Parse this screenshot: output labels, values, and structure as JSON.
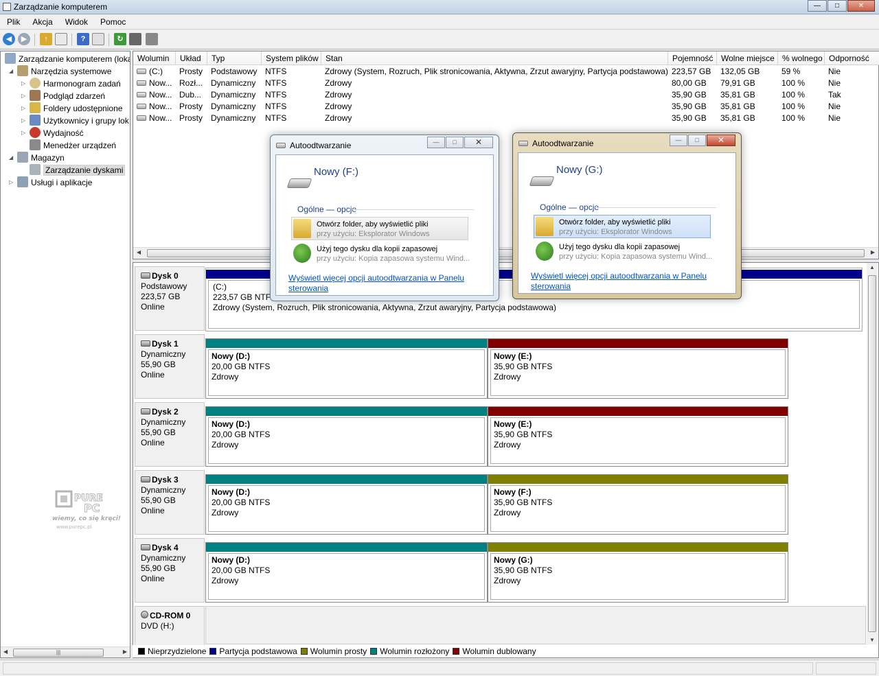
{
  "window": {
    "title": "Zarządzanie komputerem",
    "min": "—",
    "max": "□",
    "close": "✕"
  },
  "menu": [
    "Plik",
    "Akcja",
    "Widok",
    "Pomoc"
  ],
  "tree": {
    "root": "Zarządzanie komputerem (loka",
    "system_tools": "Narzędzia systemowe",
    "task_scheduler": "Harmonogram zadań",
    "event_viewer": "Podgląd zdarzeń",
    "shared_folders": "Foldery udostępnione",
    "users_groups": "Użytkownicy i grupy lok",
    "performance": "Wydajność",
    "device_manager": "Menedżer urządzeń",
    "storage": "Magazyn",
    "disk_management": "Zarządzanie dyskami",
    "services": "Usługi i aplikacje"
  },
  "volumes": {
    "columns": [
      "Wolumin",
      "Układ",
      "Typ",
      "System plików",
      "Stan",
      "Pojemność",
      "Wolne miejsce",
      "% wolnego",
      "Odporność"
    ],
    "rows": [
      [
        "(C:)",
        "Prosty",
        "Podstawowy",
        "NTFS",
        "Zdrowy (System, Rozruch, Plik stronicowania, Aktywna, Zrzut awaryjny, Partycja podstawowa)",
        "223,57 GB",
        "132,05 GB",
        "59 %",
        "Nie"
      ],
      [
        "Now...",
        "Rozł...",
        "Dynamiczny",
        "NTFS",
        "Zdrowy",
        "80,00 GB",
        "79,91 GB",
        "100 %",
        "Nie"
      ],
      [
        "Now...",
        "Dub...",
        "Dynamiczny",
        "NTFS",
        "Zdrowy",
        "35,90 GB",
        "35,81 GB",
        "100 %",
        "Tak"
      ],
      [
        "Now...",
        "Prosty",
        "Dynamiczny",
        "NTFS",
        "Zdrowy",
        "35,90 GB",
        "35,81 GB",
        "100 %",
        "Nie"
      ],
      [
        "Now...",
        "Prosty",
        "Dynamiczny",
        "NTFS",
        "Zdrowy",
        "35,90 GB",
        "35,81 GB",
        "100 %",
        "Nie"
      ]
    ]
  },
  "disks": {
    "disk0": {
      "name": "Dysk 0",
      "type": "Podstawowy",
      "size": "223,57 GB",
      "status": "Online",
      "p0": {
        "name": "(C:)",
        "size": "223,57 GB NTFS",
        "status": "Zdrowy (System, Rozruch, Plik stronicowania, Aktywna, Zrzut awaryjny, Partycja podstawowa)"
      }
    },
    "disk1": {
      "name": "Dysk 1",
      "type": "Dynamiczny",
      "size": "55,90 GB",
      "status": "Online",
      "p0": {
        "name": "Nowy  (D:)",
        "size": "20,00 GB NTFS",
        "status": "Zdrowy"
      },
      "p1": {
        "name": "Nowy  (E:)",
        "size": "35,90 GB NTFS",
        "status": "Zdrowy"
      }
    },
    "disk2": {
      "name": "Dysk 2",
      "type": "Dynamiczny",
      "size": "55,90 GB",
      "status": "Online",
      "p0": {
        "name": "Nowy  (D:)",
        "size": "20,00 GB NTFS",
        "status": "Zdrowy"
      },
      "p1": {
        "name": "Nowy  (E:)",
        "size": "35,90 GB NTFS",
        "status": "Zdrowy"
      }
    },
    "disk3": {
      "name": "Dysk 3",
      "type": "Dynamiczny",
      "size": "55,90 GB",
      "status": "Online",
      "p0": {
        "name": "Nowy  (D:)",
        "size": "20,00 GB NTFS",
        "status": "Zdrowy"
      },
      "p1": {
        "name": "Nowy  (F:)",
        "size": "35,90 GB NTFS",
        "status": "Zdrowy"
      }
    },
    "disk4": {
      "name": "Dysk 4",
      "type": "Dynamiczny",
      "size": "55,90 GB",
      "status": "Online",
      "p0": {
        "name": "Nowy  (D:)",
        "size": "20,00 GB NTFS",
        "status": "Zdrowy"
      },
      "p1": {
        "name": "Nowy  (G:)",
        "size": "35,90 GB NTFS",
        "status": "Zdrowy"
      }
    },
    "cdrom": {
      "name": "CD-ROM 0",
      "type": "DVD (H:)"
    }
  },
  "legend": [
    {
      "label": "Nieprzydzielone",
      "color": "#000000"
    },
    {
      "label": "Partycja podstawowa",
      "color": "#00008b"
    },
    {
      "label": "Wolumin prosty",
      "color": "#808000"
    },
    {
      "label": "Wolumin rozłożony",
      "color": "#008080"
    },
    {
      "label": "Wolumin dublowany",
      "color": "#800000"
    }
  ],
  "colors": {
    "primary": "#00008b",
    "spanned": "#008080",
    "mirrored": "#800000",
    "simple": "#808000"
  },
  "dialog_f": {
    "title": "Autoodtwarzanie",
    "drive": "Nowy (F:)",
    "section": "Ogólne — opcje",
    "opt1_title": "Otwórz folder, aby wyświetlić pliki",
    "opt1_sub": "przy użyciu: Eksplorator Windows",
    "opt2_title": "Użyj tego dysku dla kopii zapasowej",
    "opt2_sub": "przy użyciu: Kopia zapasowa systemu Wind...",
    "link": "Wyświetl więcej opcji autoodtwarzania w Panelu sterowania"
  },
  "dialog_g": {
    "title": "Autoodtwarzanie",
    "drive": "Nowy (G:)",
    "section": "Ogólne — opcje",
    "opt1_title": "Otwórz folder, aby wyświetlić pliki",
    "opt1_sub": "przy użyciu: Eksplorator Windows",
    "opt2_title": "Użyj tego dysku dla kopii zapasowej",
    "opt2_sub": "przy użyciu: Kopia zapasowa systemu Wind...",
    "link": "Wyświetl więcej opcji autoodtwarzania w Panelu sterowania"
  },
  "watermark": {
    "brand": "PURE PC",
    "slogan": "wiemy, co się kręci!",
    "url": "www.purepc.pl"
  }
}
